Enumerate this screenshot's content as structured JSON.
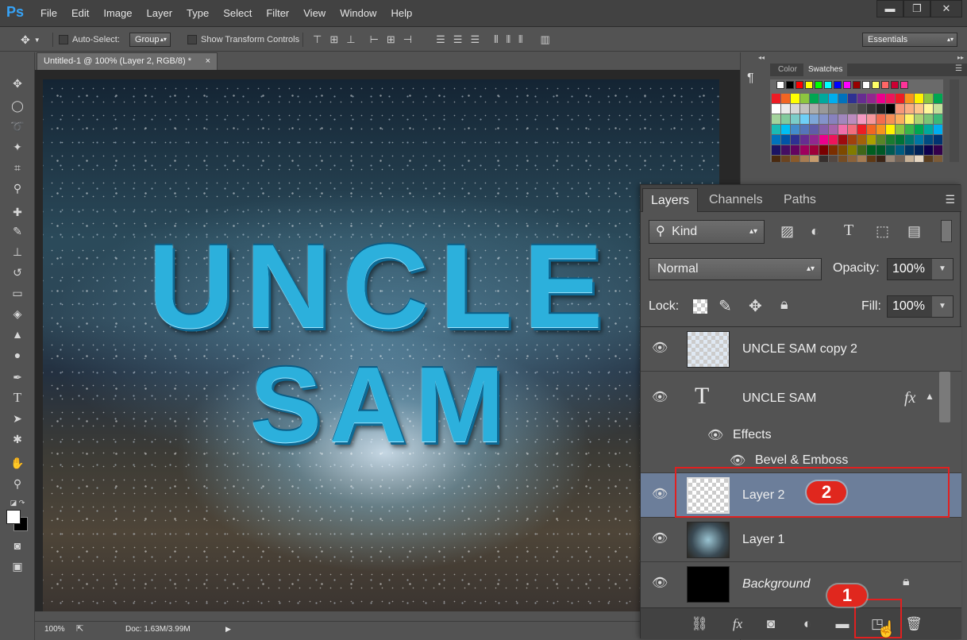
{
  "app": {
    "logo": "Ps"
  },
  "menu": [
    "File",
    "Edit",
    "Image",
    "Layer",
    "Type",
    "Select",
    "Filter",
    "View",
    "Window",
    "Help"
  ],
  "window_controls": {
    "minimize": "▬",
    "restore": "❐",
    "close": "✕"
  },
  "options": {
    "auto_select_label": "Auto-Select:",
    "auto_select_value": "Group",
    "transform_controls_label": "Show Transform Controls",
    "workspace": "Essentials"
  },
  "document": {
    "tab_title": "Untitled-1 @ 100% (Layer 2, RGB/8) *",
    "tab_close": "×",
    "text_line1": "UNCLE",
    "text_line2": "SAM"
  },
  "status": {
    "zoom": "100%",
    "doc_info": "Doc: 1.63M/3.99M"
  },
  "swatches_panel": {
    "tabs": [
      "Color",
      "Swatches"
    ],
    "active_tab": "Swatches"
  },
  "layers_panel": {
    "tabs": [
      "Layers",
      "Channels",
      "Paths"
    ],
    "active_tab": "Layers",
    "filter_kind": "Kind",
    "blend_mode": "Normal",
    "opacity_label": "Opacity:",
    "opacity_value": "100%",
    "lock_label": "Lock:",
    "fill_label": "Fill:",
    "fill_value": "100%",
    "layers": [
      {
        "name": "UNCLE SAM copy 2"
      },
      {
        "name": "UNCLE SAM",
        "fx": "fx"
      },
      {
        "name": "Effects"
      },
      {
        "name": "Bevel & Emboss"
      },
      {
        "name": "Layer 2",
        "selected": true
      },
      {
        "name": "Layer 1"
      },
      {
        "name": "Background"
      }
    ]
  },
  "annotations": {
    "step1": "1",
    "step2": "2",
    "color": "#e0271e"
  },
  "colors": {
    "selected_layer": "#6c7e9a",
    "accent_blue": "#36a3f7"
  }
}
